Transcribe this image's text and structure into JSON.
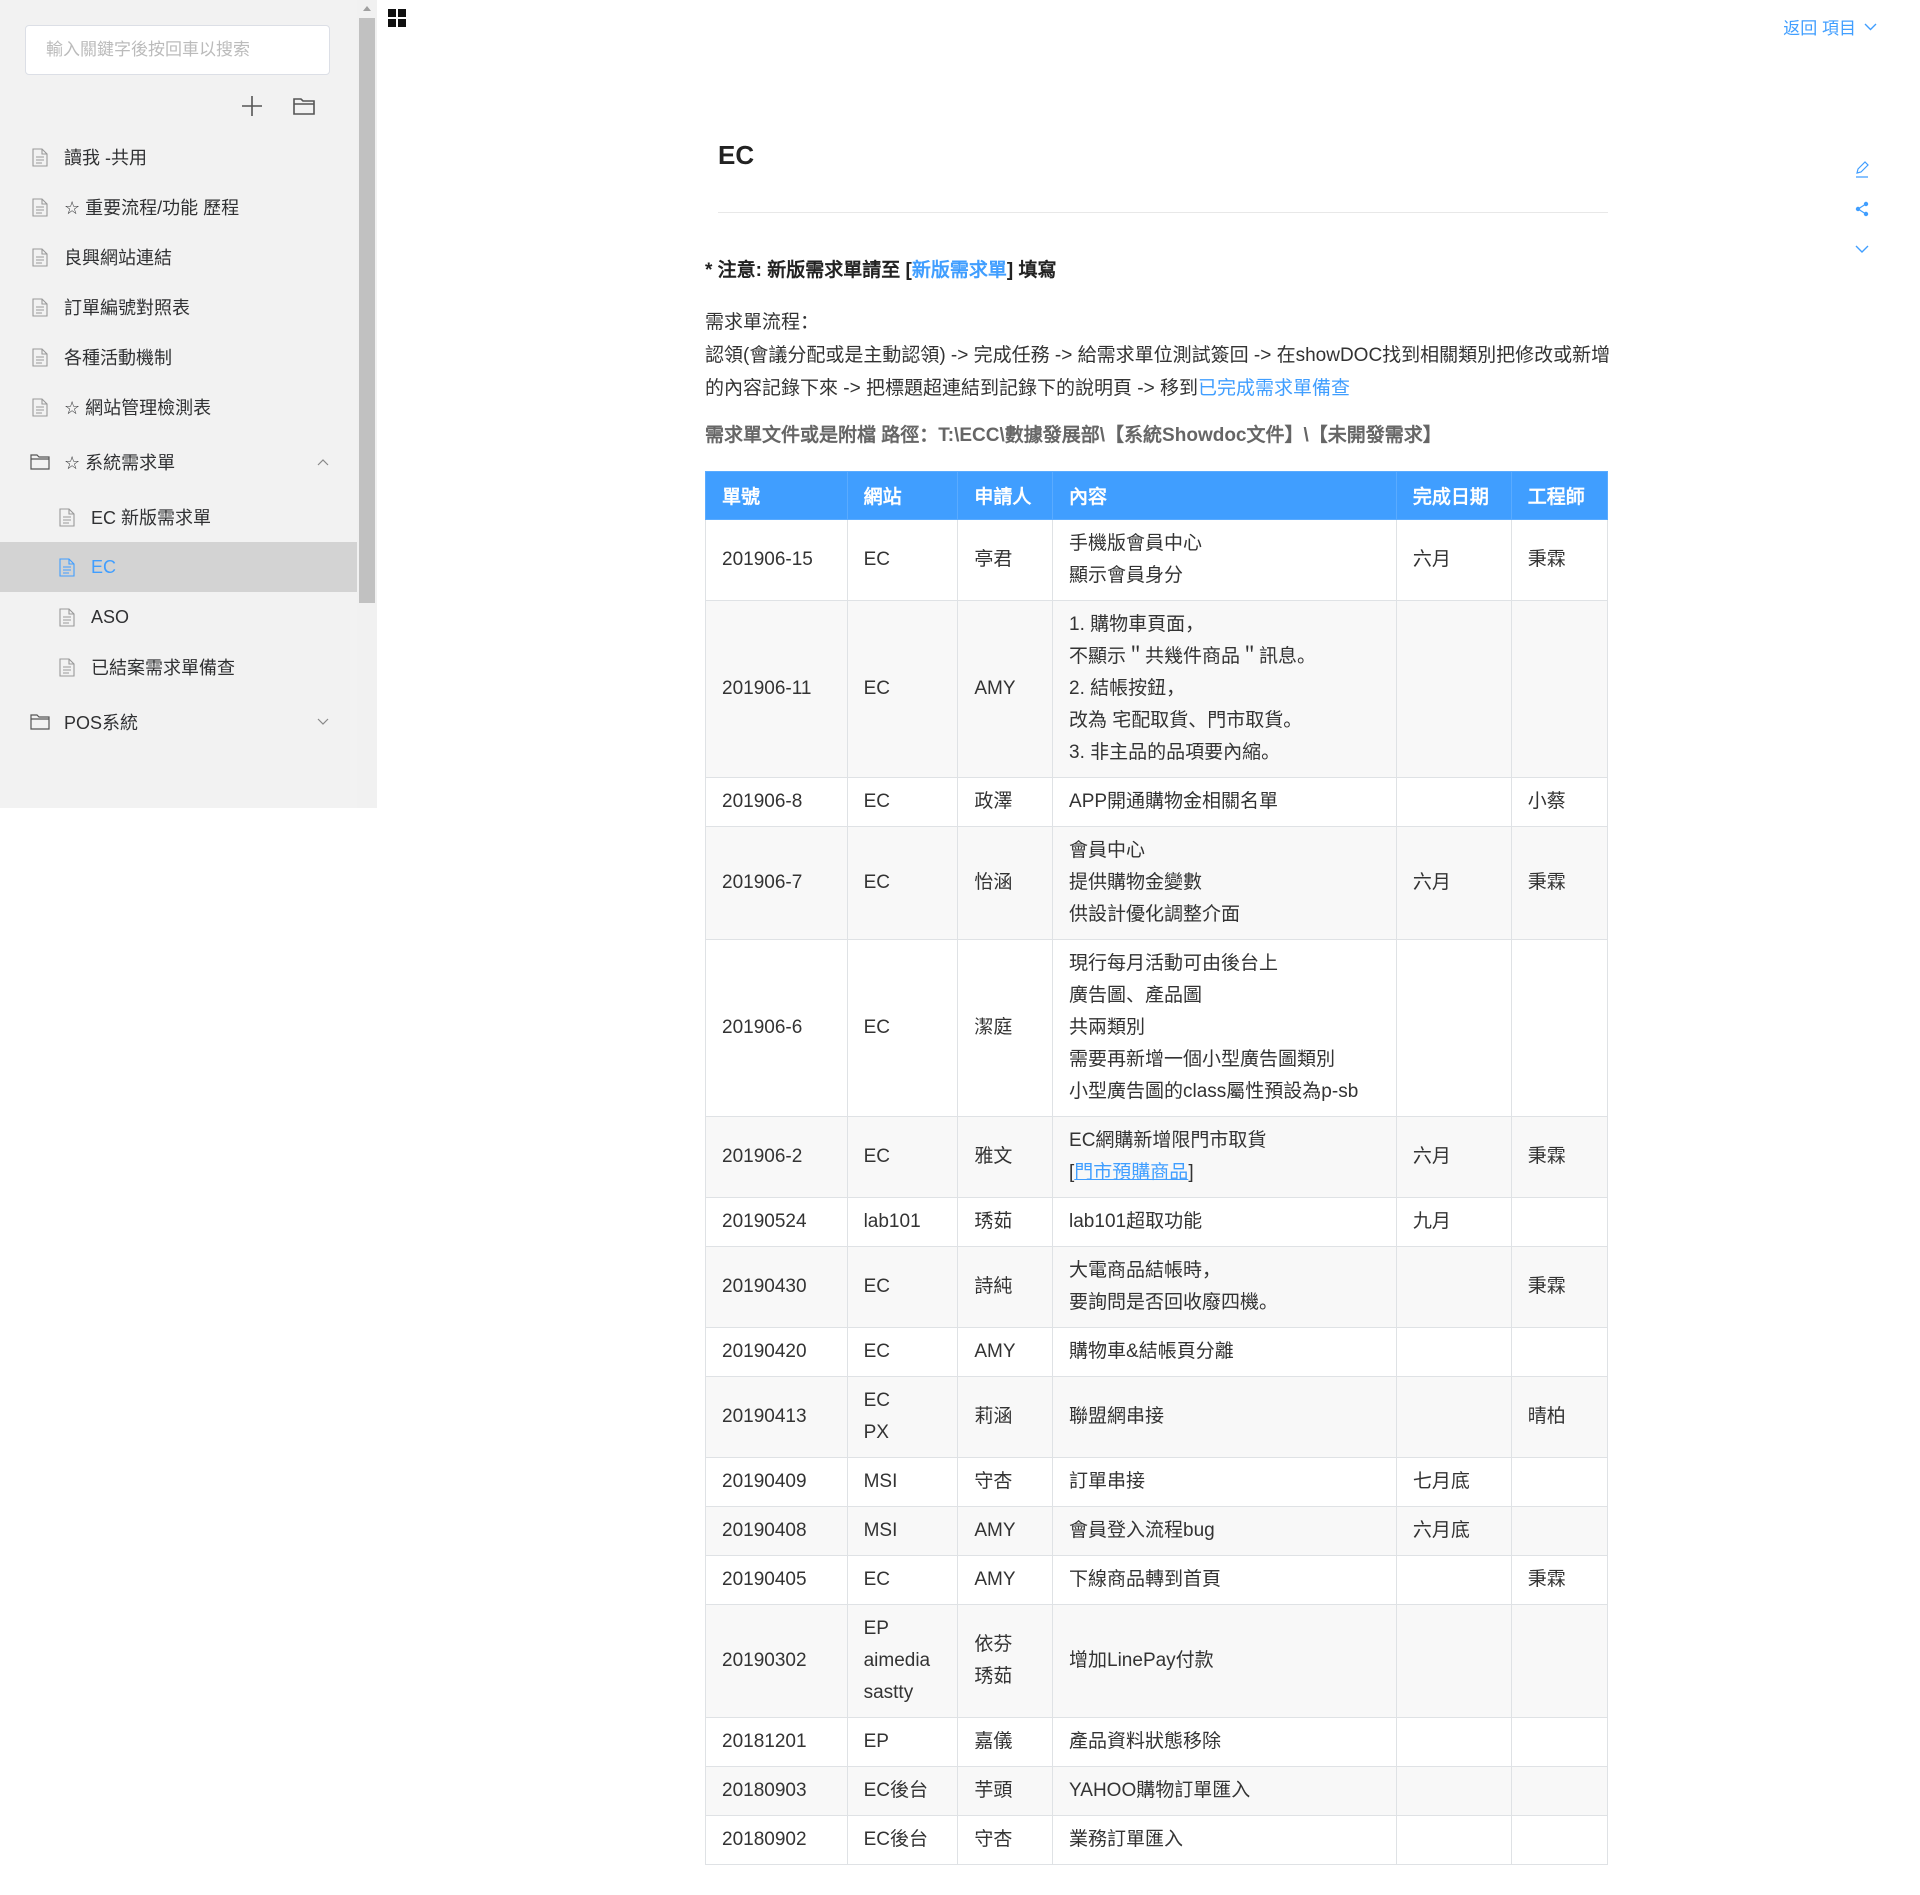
{
  "sidebar": {
    "search_placeholder": "輸入關鍵字後按回車以搜索",
    "items": [
      {
        "label": "讀我 -共用"
      },
      {
        "label": "☆ 重要流程/功能 歷程"
      },
      {
        "label": "良興網站連結"
      },
      {
        "label": "訂單編號對照表"
      },
      {
        "label": "各種活動機制"
      },
      {
        "label": "☆ 網站管理檢測表"
      }
    ],
    "folder_system": {
      "label": "☆ 系統需求單"
    },
    "subitems": [
      {
        "label": "EC 新版需求單"
      },
      {
        "label": "EC"
      },
      {
        "label": "ASO"
      },
      {
        "label": "已結案需求單備查"
      }
    ],
    "folder_pos": {
      "label": "POS系統"
    }
  },
  "header": {
    "back_label": "返回 項目"
  },
  "page": {
    "title": "EC",
    "note_prefix": "* 注意: 新版需求單請至 [",
    "note_link": "新版需求單",
    "note_suffix": "] 填寫",
    "flow_label": "需求單流程：",
    "flow_text": "認領(會議分配或是主動認領) -> 完成任務 -> 給需求單位測試簽回 -> 在showDOC找到相關類別把修改或新增的內容記錄下來 -> 把標題超連結到記錄下的說明頁 -> 移到",
    "flow_link": "已完成需求單備查",
    "path_text": "需求單文件或是附檔 路徑：T:\\ECC\\數據發展部\\【系統Showdoc文件】\\【未開發需求】"
  },
  "table": {
    "headers": [
      "單號",
      "網站",
      "申請人",
      "內容",
      "完成日期",
      "工程師"
    ],
    "rows": [
      {
        "no": "201906-15",
        "site": [
          "EC"
        ],
        "applicant": [
          "亭君"
        ],
        "content": [
          "手機版會員中心",
          "顯示會員身分"
        ],
        "date": "六月",
        "engineer": "秉霖"
      },
      {
        "no": "201906-11",
        "site": [
          "EC"
        ],
        "applicant": [
          "AMY"
        ],
        "content": [
          "1. 購物車頁面，",
          "不顯示＂共幾件商品＂訊息。",
          "2. 結帳按鈕，",
          "改為 宅配取貨、門市取貨。",
          "3. 非主品的品項要內縮。"
        ],
        "date": "",
        "engineer": ""
      },
      {
        "no": "201906-8",
        "site": [
          "EC"
        ],
        "applicant": [
          "政澤"
        ],
        "content": [
          "APP開通購物金相關名單"
        ],
        "date": "",
        "engineer": "小蔡"
      },
      {
        "no": "201906-7",
        "site": [
          "EC"
        ],
        "applicant": [
          "怡涵"
        ],
        "content": [
          "會員中心",
          "提供購物金變數",
          "供設計優化調整介面"
        ],
        "date": "六月",
        "engineer": "秉霖"
      },
      {
        "no": "201906-6",
        "site": [
          "EC"
        ],
        "applicant": [
          "潔庭"
        ],
        "content": [
          "現行每月活動可由後台上",
          "廣告圖、產品圖",
          "共兩類別",
          "需要再新增一個小型廣告圖類別",
          "小型廣告圖的class屬性預設為p-sb"
        ],
        "date": "",
        "engineer": ""
      },
      {
        "no": "201906-2",
        "site": [
          "EC"
        ],
        "applicant": [
          "雅文"
        ],
        "content": [
          "EC網購新增限門市取貨"
        ],
        "content_link": "門市預購商品",
        "date": "六月",
        "engineer": "秉霖"
      },
      {
        "no": "20190524",
        "site": [
          "lab101"
        ],
        "applicant": [
          "琇茹"
        ],
        "content": [
          "lab101超取功能"
        ],
        "date": "九月",
        "engineer": ""
      },
      {
        "no": "20190430",
        "site": [
          "EC"
        ],
        "applicant": [
          "詩純"
        ],
        "content": [
          "大電商品結帳時，",
          "要詢問是否回收廢四機。"
        ],
        "date": "",
        "engineer": "秉霖"
      },
      {
        "no": "20190420",
        "site": [
          "EC"
        ],
        "applicant": [
          "AMY"
        ],
        "content": [
          "購物車&結帳頁分離"
        ],
        "date": "",
        "engineer": ""
      },
      {
        "no": "20190413",
        "site": [
          "EC",
          "PX"
        ],
        "applicant": [
          "莉涵"
        ],
        "content": [
          "聯盟網串接"
        ],
        "date": "",
        "engineer": "晴柏"
      },
      {
        "no": "20190409",
        "site": [
          "MSI"
        ],
        "applicant": [
          "守杏"
        ],
        "content": [
          "訂單串接"
        ],
        "date": "七月底",
        "engineer": ""
      },
      {
        "no": "20190408",
        "site": [
          "MSI"
        ],
        "applicant": [
          "AMY"
        ],
        "content": [
          "會員登入流程bug"
        ],
        "date": "六月底",
        "engineer": ""
      },
      {
        "no": "20190405",
        "site": [
          "EC"
        ],
        "applicant": [
          "AMY"
        ],
        "content": [
          "下線商品轉到首頁"
        ],
        "date": "",
        "engineer": "秉霖"
      },
      {
        "no": "20190302",
        "site": [
          "EP",
          "aimedia",
          "sastty"
        ],
        "applicant": [
          "依芬",
          "琇茹"
        ],
        "content": [
          "增加LinePay付款"
        ],
        "date": "",
        "engineer": ""
      },
      {
        "no": "20181201",
        "site": [
          "EP"
        ],
        "applicant": [
          "嘉儀"
        ],
        "content": [
          "產品資料狀態移除"
        ],
        "date": "",
        "engineer": ""
      },
      {
        "no": "20180903",
        "site": [
          "EC後台"
        ],
        "applicant": [
          "芋頭"
        ],
        "content": [
          "YAHOO購物訂單匯入"
        ],
        "date": "",
        "engineer": ""
      },
      {
        "no": "20180902",
        "site": [
          "EC後台"
        ],
        "applicant": [
          "守杏"
        ],
        "content": [
          "業務訂單匯入"
        ],
        "date": "",
        "engineer": ""
      }
    ]
  },
  "icons": {
    "doc": "document-icon",
    "folder": "folder-icon",
    "add": "plus-icon",
    "accent": "#409eff"
  }
}
